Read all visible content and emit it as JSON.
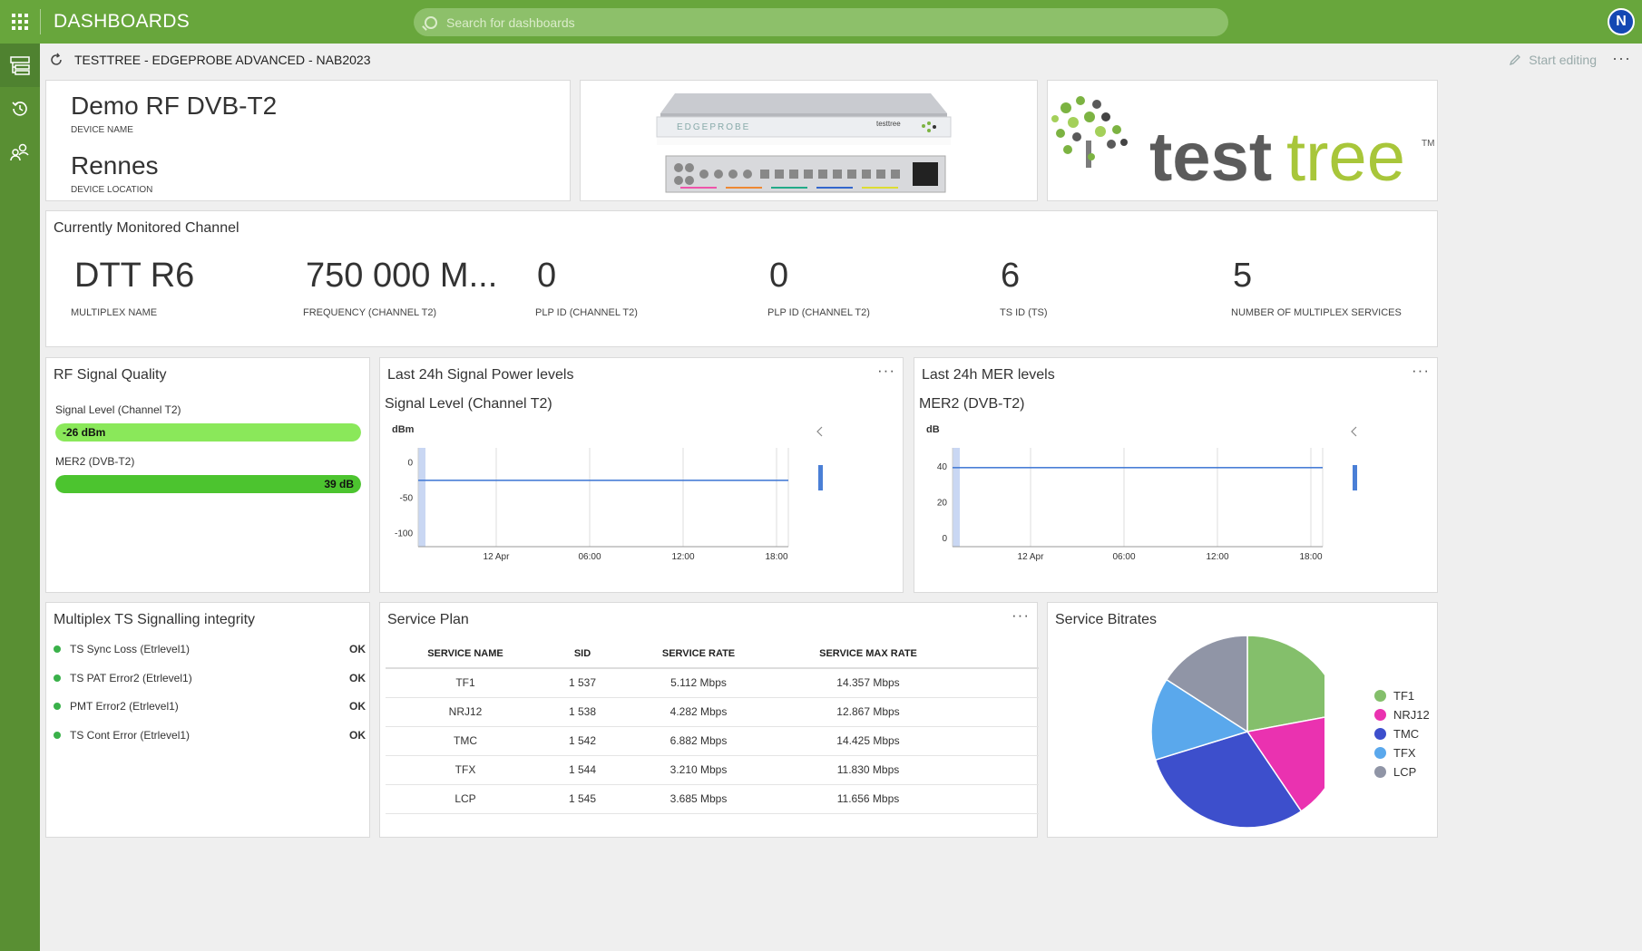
{
  "app": {
    "title": "DASHBOARDS",
    "search_placeholder": "Search for dashboards",
    "user_initial": "N"
  },
  "breadcrumb": {
    "path": "TESTTREE - EDGEPROBE ADVANCED - NAB2023",
    "start_editing": "Start editing"
  },
  "device": {
    "name": "Demo RF DVB-T2",
    "name_caption": "DEVICE NAME",
    "location": "Rennes",
    "location_caption": "DEVICE LOCATION"
  },
  "product_image": {
    "brand": "EDGEPROBE",
    "badge": "testtree"
  },
  "logo": {
    "part1": "test",
    "part2": "tree",
    "tm": "TM"
  },
  "channel": {
    "title": "Currently Monitored Channel",
    "items": [
      {
        "value": "DTT R6",
        "caption": "MULTIPLEX NAME"
      },
      {
        "value": "750 000 M...",
        "caption": "FREQUENCY (CHANNEL T2)"
      },
      {
        "value": "0",
        "caption": "PLP ID (CHANNEL T2)"
      },
      {
        "value": "0",
        "caption": "PLP ID (CHANNEL T2)"
      },
      {
        "value": "6",
        "caption": "TS ID (TS)"
      },
      {
        "value": "5",
        "caption": "NUMBER OF MULTIPLEX SERVICES"
      }
    ]
  },
  "rf_quality": {
    "title": "RF Signal Quality",
    "signal_label": "Signal Level (Channel T2)",
    "signal_value": "-26 dBm",
    "signal_fill": 1.0,
    "signal_color": "#8ae85a",
    "mer_label": "MER2 (DVB-T2)",
    "mer_value": "39 dB",
    "mer_fill": 1.0,
    "mer_color": "#4cc42f"
  },
  "signal_chart": {
    "title": "Last 24h Signal Power levels",
    "subtitle": "Signal Level (Channel T2)",
    "unit": "dBm"
  },
  "mer_chart": {
    "title": "Last 24h MER levels",
    "subtitle": "MER2 (DVB-T2)",
    "unit": "dB"
  },
  "chart_data": [
    {
      "type": "line",
      "ylabel": "dBm",
      "ylim": [
        -120,
        20
      ],
      "yticks": [
        "0",
        "-50",
        "-100"
      ],
      "xticks": [
        "12 Apr",
        "06:00",
        "12:00",
        "18:00"
      ],
      "series": [
        {
          "values": [
            -26,
            -26,
            -26,
            -26,
            -26,
            -26,
            -26,
            -26,
            -26,
            -26,
            -26,
            -26
          ]
        }
      ]
    },
    {
      "type": "line",
      "ylabel": "dB",
      "ylim": [
        -5,
        50
      ],
      "yticks": [
        "40",
        "20",
        "0"
      ],
      "xticks": [
        "12 Apr",
        "06:00",
        "12:00",
        "18:00"
      ],
      "series": [
        {
          "values": [
            39,
            39,
            39,
            39,
            39,
            39,
            39,
            39,
            39,
            39,
            39,
            39
          ]
        }
      ]
    },
    {
      "type": "pie",
      "title": "Service Bitrates",
      "labels": [
        "TF1",
        "NRJ12",
        "TMC",
        "TFX",
        "LCP"
      ],
      "values": [
        5.112,
        4.282,
        6.882,
        3.21,
        3.685
      ],
      "colors": [
        "#84bf6b",
        "#ea32b0",
        "#3d4fcc",
        "#5aa8ec",
        "#9095a6"
      ]
    }
  ],
  "integrity": {
    "title": "Multiplex TS Signalling integrity",
    "items": [
      {
        "label": "TS Sync Loss (Etrlevel1)",
        "status": "OK"
      },
      {
        "label": "TS PAT Error2 (Etrlevel1)",
        "status": "OK"
      },
      {
        "label": "PMT Error2 (Etrlevel1)",
        "status": "OK"
      },
      {
        "label": "TS Cont Error (Etrlevel1)",
        "status": "OK"
      }
    ]
  },
  "service_plan": {
    "title": "Service Plan",
    "headers": [
      "SERVICE NAME",
      "SID",
      "SERVICE RATE",
      "SERVICE MAX RATE"
    ],
    "rows": [
      [
        "TF1",
        "1 537",
        "5.112 Mbps",
        "14.357 Mbps"
      ],
      [
        "NRJ12",
        "1 538",
        "4.282 Mbps",
        "12.867 Mbps"
      ],
      [
        "TMC",
        "1 542",
        "6.882 Mbps",
        "14.425 Mbps"
      ],
      [
        "TFX",
        "1 544",
        "3.210 Mbps",
        "11.830 Mbps"
      ],
      [
        "LCP",
        "1 545",
        "3.685 Mbps",
        "11.656 Mbps"
      ]
    ]
  },
  "bitrates": {
    "title": "Service Bitrates"
  }
}
